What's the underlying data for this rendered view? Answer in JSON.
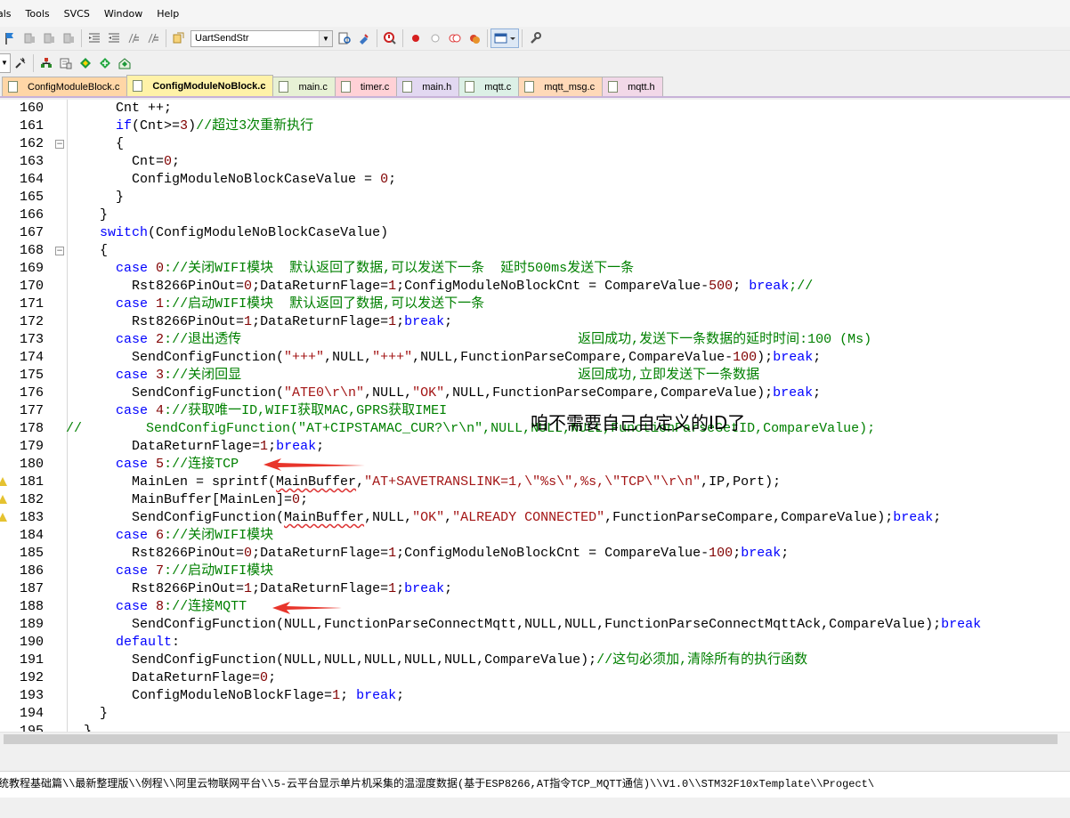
{
  "menu": [
    "als",
    "Tools",
    "SVCS",
    "Window",
    "Help"
  ],
  "toolbar": {
    "target_combo": "UartSendStr"
  },
  "tabs": [
    {
      "label": "ConfigModuleBlock.c",
      "color": "#ffd6a6",
      "active": false
    },
    {
      "label": "ConfigModuleNoBlock.c",
      "color": "#fff2a8",
      "active": true
    },
    {
      "label": "main.c",
      "color": "#e7f1d5",
      "active": false
    },
    {
      "label": "timer.c",
      "color": "#ffd1d6",
      "active": false
    },
    {
      "label": "main.h",
      "color": "#e2d8f1",
      "active": false
    },
    {
      "label": "mqtt.c",
      "color": "#dcf0e6",
      "active": false
    },
    {
      "label": "mqtt_msg.c",
      "color": "#ffd9b8",
      "active": false
    },
    {
      "label": "mqtt.h",
      "color": "#f2d8e8",
      "active": false
    }
  ],
  "lines": [
    {
      "n": "160",
      "fold": false,
      "warn": false
    },
    {
      "n": "161",
      "fold": false,
      "warn": false
    },
    {
      "n": "162",
      "fold": true,
      "warn": false
    },
    {
      "n": "163",
      "fold": false,
      "warn": false
    },
    {
      "n": "164",
      "fold": false,
      "warn": false
    },
    {
      "n": "165",
      "fold": false,
      "warn": false
    },
    {
      "n": "166",
      "fold": false,
      "warn": false
    },
    {
      "n": "167",
      "fold": false,
      "warn": false
    },
    {
      "n": "168",
      "fold": true,
      "warn": false
    },
    {
      "n": "169",
      "fold": false,
      "warn": false
    },
    {
      "n": "170",
      "fold": false,
      "warn": false
    },
    {
      "n": "171",
      "fold": false,
      "warn": false
    },
    {
      "n": "172",
      "fold": false,
      "warn": false
    },
    {
      "n": "173",
      "fold": false,
      "warn": false
    },
    {
      "n": "174",
      "fold": false,
      "warn": false
    },
    {
      "n": "175",
      "fold": false,
      "warn": false
    },
    {
      "n": "176",
      "fold": false,
      "warn": false
    },
    {
      "n": "177",
      "fold": false,
      "warn": false
    },
    {
      "n": "178",
      "fold": false,
      "warn": false
    },
    {
      "n": "179",
      "fold": false,
      "warn": false
    },
    {
      "n": "180",
      "fold": false,
      "warn": false
    },
    {
      "n": "181",
      "fold": false,
      "warn": true
    },
    {
      "n": "182",
      "fold": false,
      "warn": true
    },
    {
      "n": "183",
      "fold": false,
      "warn": true
    },
    {
      "n": "184",
      "fold": false,
      "warn": false
    },
    {
      "n": "185",
      "fold": false,
      "warn": false
    },
    {
      "n": "186",
      "fold": false,
      "warn": false
    },
    {
      "n": "187",
      "fold": false,
      "warn": false
    },
    {
      "n": "188",
      "fold": false,
      "warn": false
    },
    {
      "n": "189",
      "fold": false,
      "warn": false
    },
    {
      "n": "190",
      "fold": false,
      "warn": false
    },
    {
      "n": "191",
      "fold": false,
      "warn": false
    },
    {
      "n": "192",
      "fold": false,
      "warn": false
    },
    {
      "n": "193",
      "fold": false,
      "warn": false
    },
    {
      "n": "194",
      "fold": false,
      "warn": false
    },
    {
      "n": "195",
      "fold": false,
      "warn": false
    }
  ],
  "code": {
    "l160": "      Cnt ++;",
    "l161_kw": "if",
    "l161_a": "(Cnt>=",
    "l161_num": "3",
    "l161_b": ")",
    "l161_cm": "//超过3次重新执行",
    "l162": "      {",
    "l163_a": "        Cnt=",
    "l163_num": "0",
    "l163_b": ";",
    "l164_a": "        ConfigModuleNoBlockCaseValue = ",
    "l164_num": "0",
    "l164_b": ";",
    "l165": "      }",
    "l166": "    }",
    "l167_kw": "switch",
    "l167_a": "(ConfigModuleNoBlockCaseValue)",
    "l168": "    {",
    "l169_kw": "case",
    "l169_num": "0",
    "l169_cm": "://关闭WIFI模块  默认返回了数据,可以发送下一条  延时500ms发送下一条",
    "l170_a": "        Rst8266PinOut=",
    "l170_n1": "0",
    "l170_b": ";DataReturnFlage=",
    "l170_n2": "1",
    "l170_c": ";ConfigModuleNoBlockCnt = CompareValue-",
    "l170_n3": "500",
    "l170_d": "; ",
    "l170_kw": "break",
    "l170_cm": ";//",
    "l171_kw": "case",
    "l171_num": "1",
    "l171_cm": "://启动WIFI模块  默认返回了数据,可以发送下一条",
    "l172_a": "        Rst8266PinOut=",
    "l172_n1": "1",
    "l172_b": ";DataReturnFlage=",
    "l172_n2": "1",
    "l172_c": ";",
    "l172_kw": "break",
    "l172_d": ";",
    "l173_kw": "case",
    "l173_num": "2",
    "l173_cm": "://退出透传                                          返回成功,发送下一条数据的延时时间:100 (Ms)",
    "l174_a": "        SendConfigFunction(",
    "l174_s1": "\"+++\"",
    "l174_b": ",NULL,",
    "l174_s2": "\"+++\"",
    "l174_c": ",NULL,FunctionParseCompare,CompareValue-",
    "l174_n": "100",
    "l174_d": ");",
    "l174_kw": "break",
    "l174_e": ";",
    "l175_kw": "case",
    "l175_num": "3",
    "l175_cm": "://关闭回显                                          返回成功,立即发送下一条数据",
    "l176_a": "        SendConfigFunction(",
    "l176_s1": "\"ATE0\\r\\n\"",
    "l176_b": ",NULL,",
    "l176_s2": "\"OK\"",
    "l176_c": ",NULL,FunctionParseCompare,CompareValue);",
    "l176_kw": "break",
    "l176_d": ";",
    "l177_kw": "case",
    "l177_num": "4",
    "l177_cm": "://获取唯一ID,WIFI获取MAC,GPRS获取IMEI",
    "l178_cm": "//        SendConfigFunction(\"AT+CIPSTAMAC_CUR?\\r\\n\",NULL,NULL,NULL,FunctionParseGetID,CompareValue);",
    "l179_a": "        DataReturnFlage=",
    "l179_n": "1",
    "l179_b": ";",
    "l179_kw": "break",
    "l179_c": ";",
    "l180_kw": "case",
    "l180_num": "5",
    "l180_cm": "://连接TCP",
    "l181_a": "        MainLen = sprintf(",
    "l181_sq": "MainBuffer",
    "l181_b": ",",
    "l181_s": "\"AT+SAVETRANSLINK=1,\\\"%s\\\",%s,\\\"TCP\\\"\\r\\n\"",
    "l181_c": ",IP,Port);",
    "l182_a": "        MainBuffer[MainLen]=",
    "l182_n": "0",
    "l182_b": ";",
    "l183_a": "        SendConfigFunction(",
    "l183_sq": "MainBuffer",
    "l183_b": ",NULL,",
    "l183_s1": "\"OK\"",
    "l183_c": ",",
    "l183_s2": "\"ALREADY CONNECTED\"",
    "l183_d": ",FunctionParseCompare,CompareValue);",
    "l183_kw": "break",
    "l183_e": ";",
    "l184_kw": "case",
    "l184_num": "6",
    "l184_cm": "://关闭WIFI模块",
    "l185_a": "        Rst8266PinOut=",
    "l185_n1": "0",
    "l185_b": ";DataReturnFlage=",
    "l185_n2": "1",
    "l185_c": ";ConfigModuleNoBlockCnt = CompareValue-",
    "l185_n3": "100",
    "l185_d": ";",
    "l185_kw": "break",
    "l185_e": ";",
    "l186_kw": "case",
    "l186_num": "7",
    "l186_cm": "://启动WIFI模块",
    "l187_a": "        Rst8266PinOut=",
    "l187_n1": "1",
    "l187_b": ";DataReturnFlage=",
    "l187_n2": "1",
    "l187_c": ";",
    "l187_kw": "break",
    "l187_d": ";",
    "l188_kw": "case",
    "l188_num": "8",
    "l188_cm": "://连接MQTT",
    "l189_a": "        SendConfigFunction(NULL,FunctionParseConnectMqtt,NULL,NULL,FunctionParseConnectMqttAck,CompareValue);",
    "l189_kw": "break",
    "l190_kw": "default",
    "l190_a": ":",
    "l191_a": "        SendConfigFunction(NULL,NULL,NULL,NULL,NULL,CompareValue);",
    "l191_cm": "//这句必须加,清除所有的执行函数",
    "l192_a": "        DataReturnFlage=",
    "l192_n": "0",
    "l192_b": ";",
    "l193_a": "        ConfigModuleNoBlockFlage=",
    "l193_n": "1",
    "l193_b": "; ",
    "l193_kw": "break",
    "l193_c": ";",
    "l194": "    }",
    "l195": "  }"
  },
  "annotation": "咱不需要自己自定义的ID了",
  "status_path": "统教程基础篇\\\\最新整理版\\\\例程\\\\阿里云物联网平台\\\\5-云平台显示单片机采集的温湿度数据(基于ESP8266,AT指令TCP_MQTT通信)\\\\V1.0\\\\STM32F10xTemplate\\\\Progect\\",
  "colors": {
    "keyword": "#0000ff",
    "comment": "#008000",
    "string": "#a31515",
    "number": "#800000",
    "arrow": "#e8352b"
  }
}
